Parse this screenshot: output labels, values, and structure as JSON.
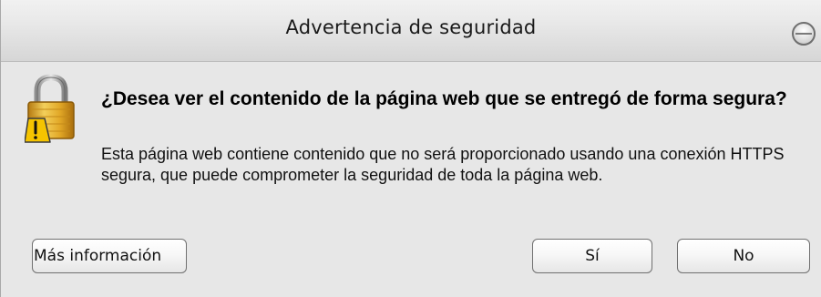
{
  "window": {
    "title": "Advertencia de seguridad"
  },
  "dialog": {
    "heading": "¿Desea ver el contenido de la página web que se entregó de forma segura?",
    "message": "Esta página web contiene contenido que no será proporcionado usando una conexión HTTPS segura, que puede comprometer la seguridad de toda la página web.",
    "icon": "lock-warning-icon"
  },
  "buttons": {
    "more_info": "Más información",
    "yes": "Sí",
    "no": "No"
  },
  "colors": {
    "background": "#e7e7e7",
    "titlebar": "#e0e0e0",
    "lock_gold": "#e0a824",
    "warning_yellow": "#f5c400"
  }
}
